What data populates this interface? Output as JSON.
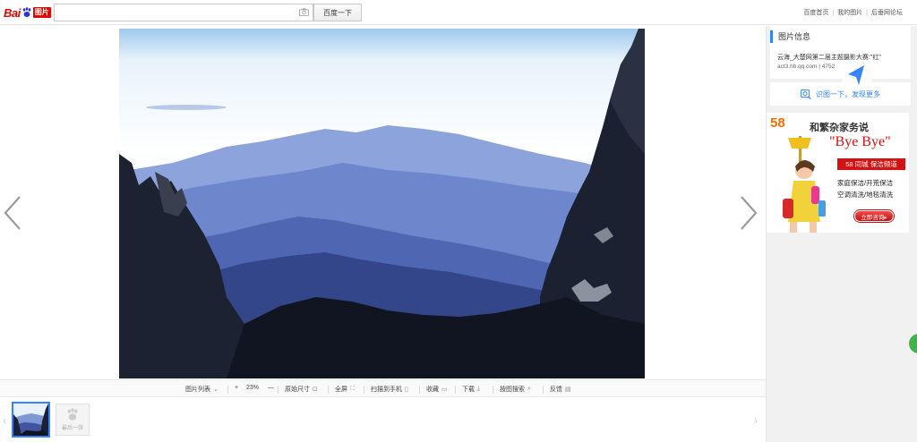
{
  "header": {
    "logo_text": "Bai",
    "logo_tag": "图片",
    "search_value": "",
    "search_button": "百度一下",
    "links": [
      "百度首页",
      "我的图片",
      "后垂网论坛"
    ]
  },
  "viewer": {
    "image_alt": "黄山云海"
  },
  "toolbar": {
    "list": "图片列表",
    "zoom_in": "+",
    "zoom": "23%",
    "zoom_out": "—",
    "original": "原始尺寸",
    "fullscreen": "全屏",
    "scan_phone": "扫描到手机",
    "favorite": "收藏",
    "download": "下载",
    "search_by_image": "按图搜索",
    "feedback": "反馈"
  },
  "strip": {
    "last_label": "最后一张"
  },
  "side": {
    "info_title": "图片信息",
    "desc": "云海_大楚网第二届主题摄影大赛:\"红\"",
    "meta": "act3.hb.qq.com  |  4752",
    "shitu": "识图一下，发现更多"
  },
  "ad": {
    "brand": "58",
    "headline": "和繁杂家务说",
    "bye": "\"Bye Bye\"",
    "band": "58 同城 保洁频道",
    "line1": "家庭保洁/开荒保洁",
    "line2": "空调清洗/地毯清洗",
    "cta": "立即咨询▸"
  },
  "colors": {
    "accent": "#3385ff",
    "brand_red": "#e10602",
    "ad_red": "#d31313"
  }
}
